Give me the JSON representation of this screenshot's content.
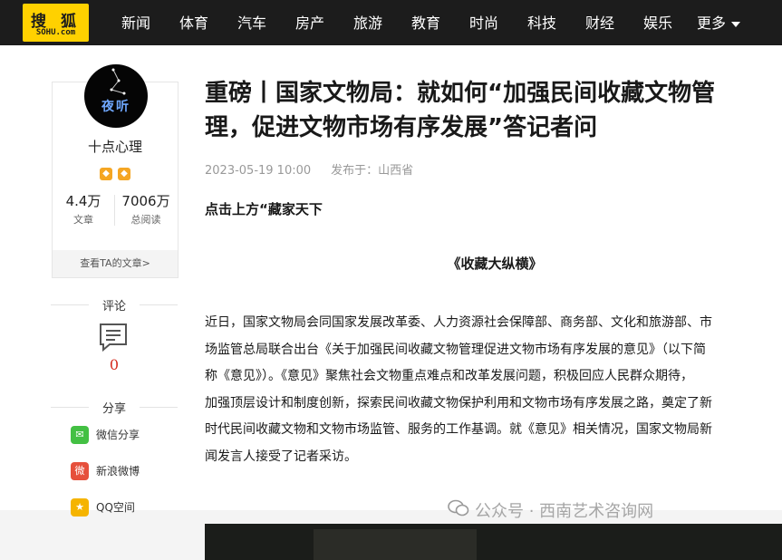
{
  "logo": {
    "cn": "搜 狐",
    "en": "SOHU.com"
  },
  "nav": {
    "items": [
      "新闻",
      "体育",
      "汽车",
      "房产",
      "旅游",
      "教育",
      "时尚",
      "科技",
      "财经",
      "娱乐"
    ],
    "more_label": "更多"
  },
  "author": {
    "avatar_text": "夜听",
    "name": "十点心理",
    "badge_icons": [
      "fox-badge-icon",
      "fox-badge-icon"
    ],
    "articles_count": "4.4万",
    "articles_label": "文章",
    "reads_count": "7006万",
    "reads_label": "总阅读",
    "view_articles_label": "查看TA的文章>"
  },
  "comments": {
    "label": "评论",
    "count": "0"
  },
  "share": {
    "label": "分享",
    "items": [
      {
        "label": "微信分享",
        "icon": "wechat-icon",
        "color": "#43c043",
        "glyph": "✉"
      },
      {
        "label": "新浪微博",
        "icon": "weibo-icon",
        "color": "#e6503c",
        "glyph": "微"
      },
      {
        "label": "QQ空间",
        "icon": "qzone-icon",
        "color": "#f5b400",
        "glyph": "★"
      }
    ]
  },
  "article": {
    "title_line1": "重磅丨国家文物局：就如何“加强民间收藏文物管",
    "title_line2": "理，促进文物市场有序发展”答记者问",
    "date": "2023-05-19 10:00",
    "location": "发布于：山西省",
    "lead": "点击上方“藏家天下",
    "subtitle": "《收藏大纵横》",
    "body_lines": [
      "近日，国家文物局会同国家发展改革委、人力资源社会保障部、商务部、文化和旅游部、市",
      "场监管总局联合出台《关于加强民间收藏文物管理促进文物市场有序发展的意见》（以下简",
      "称《意见》）。《意见》聚焦社会文物重点难点和改革发展问题，积极回应人民群众期待，",
      "加强顶层设计和制度创新，探索民间收藏文物保护利用和文物市场有序发展之路，奠定了新",
      "时代民间收藏文物和文物市场监管、服务的工作基调。就《意见》相关情况，国家文物局新",
      "闻发言人接受了记者采访。"
    ],
    "watermark": "公众号 · 西南艺术咨询网"
  },
  "colors": {
    "topbar": "#1c1c1c",
    "logo": "#ffd100",
    "comment_count": "#d52b1e"
  }
}
